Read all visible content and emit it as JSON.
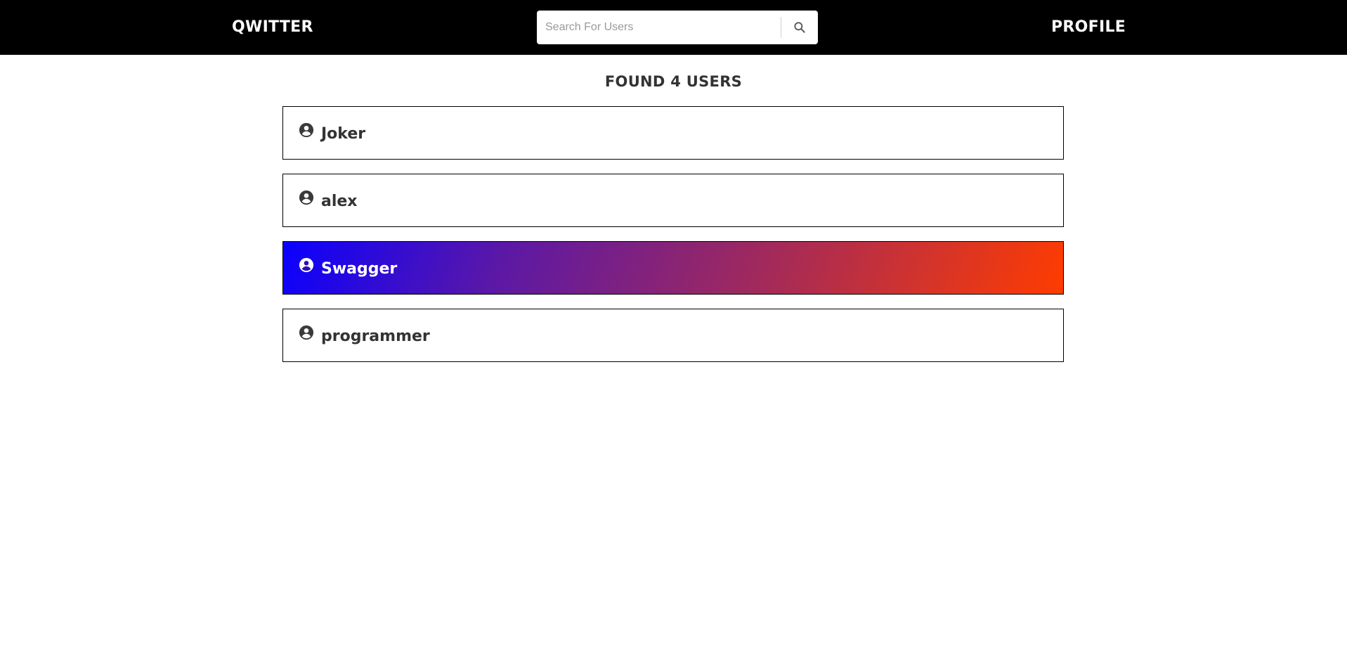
{
  "header": {
    "brand": "QWITTER",
    "profile_label": "PROFILE",
    "search": {
      "placeholder": "Search For Users",
      "value": "",
      "button_icon": "search-icon"
    }
  },
  "results": {
    "heading": "FOUND 4 USERS",
    "users": [
      {
        "name": "Joker",
        "icon": "account-circle-icon",
        "highlighted": false
      },
      {
        "name": "alex",
        "icon": "account-circle-icon",
        "highlighted": false
      },
      {
        "name": "Swagger",
        "icon": "account-circle-icon",
        "highlighted": true
      },
      {
        "name": "programmer",
        "icon": "account-circle-icon",
        "highlighted": false
      }
    ]
  },
  "colors": {
    "header_bg": "#000000",
    "text_dark": "#333333",
    "highlight_gradient_start": "#0a00ff",
    "highlight_gradient_end": "#ff3c00"
  }
}
